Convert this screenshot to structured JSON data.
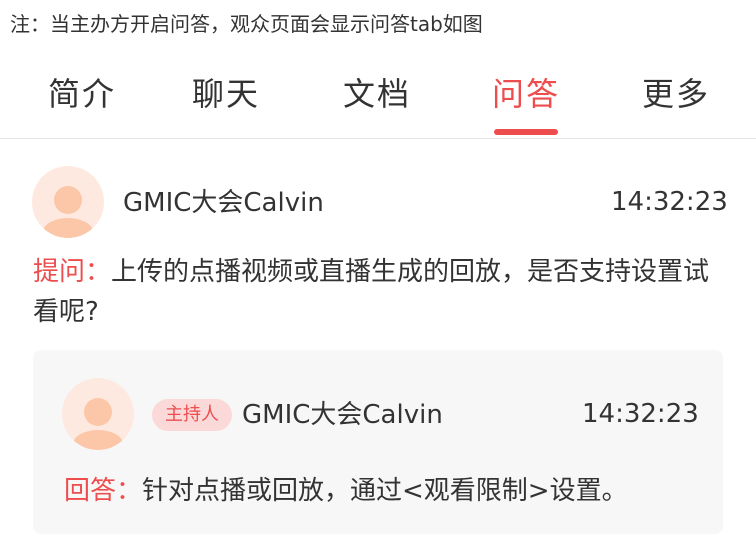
{
  "note": "注：当主办方开启问答，观众页面会显示问答tab如图",
  "tabs": [
    {
      "label": "简介"
    },
    {
      "label": "聊天"
    },
    {
      "label": "文档"
    },
    {
      "label": "问答"
    },
    {
      "label": "更多"
    }
  ],
  "active_tab": "问答",
  "question": {
    "user": "GMIC大会Calvin",
    "time": "14:32:23",
    "label": "提问：",
    "text": "上传的点播视频或直播生成的回放，是否支持设置试看呢?"
  },
  "answer": {
    "badge": "主持人",
    "user": "GMIC大会Calvin",
    "time": "14:32:23",
    "label": "回答：",
    "text": "针对点播或回放，通过<观看限制>设置。"
  },
  "colors": {
    "accent": "#ee4d4d",
    "text": "#333333",
    "card_bg": "#f7f7f7",
    "avatar_bg": "#fde9df",
    "avatar_fg": "#fcc7a8"
  },
  "icons": {
    "avatar": "user-avatar-icon"
  }
}
